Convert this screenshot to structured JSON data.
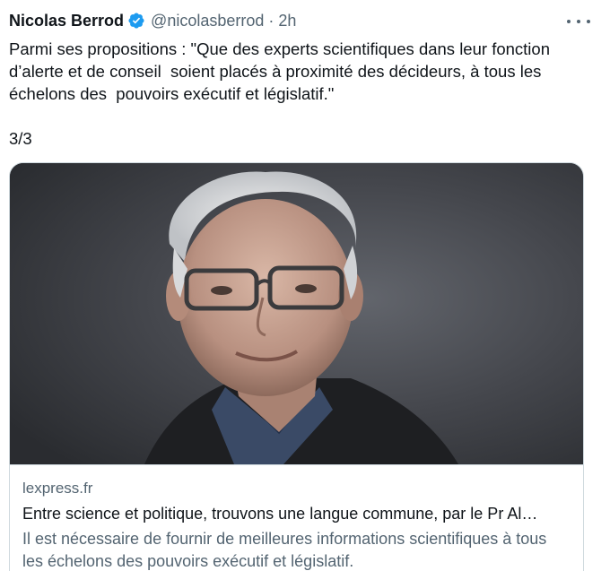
{
  "tweet": {
    "author_name": "Nicolas Berrod",
    "handle": "@nicolasberrod",
    "separator": "·",
    "time": "2h",
    "text": "Parmi ses propositions : \"Que des experts scientifiques dans leur fonction\nd’alerte et de conseil  soient placés à proximité des décideurs, à tous les\néchelons des  pouvoirs exécutif et législatif.\"\n\n3/3"
  },
  "card": {
    "domain": "lexpress.fr",
    "title": "Entre science et politique, trouvons une langue commune, par le Pr Al…",
    "description": "Il est nécessaire de fournir de meilleures informations scientifiques à tous les échelons des pouvoirs exécutif et législatif."
  },
  "colors": {
    "verified_badge": "#1d9bf0",
    "secondary_text": "#536471",
    "primary_text": "#0f1419",
    "border": "#cfd9de"
  },
  "icons": {
    "verified": "verified-badge-icon",
    "more": "more-options-icon"
  }
}
